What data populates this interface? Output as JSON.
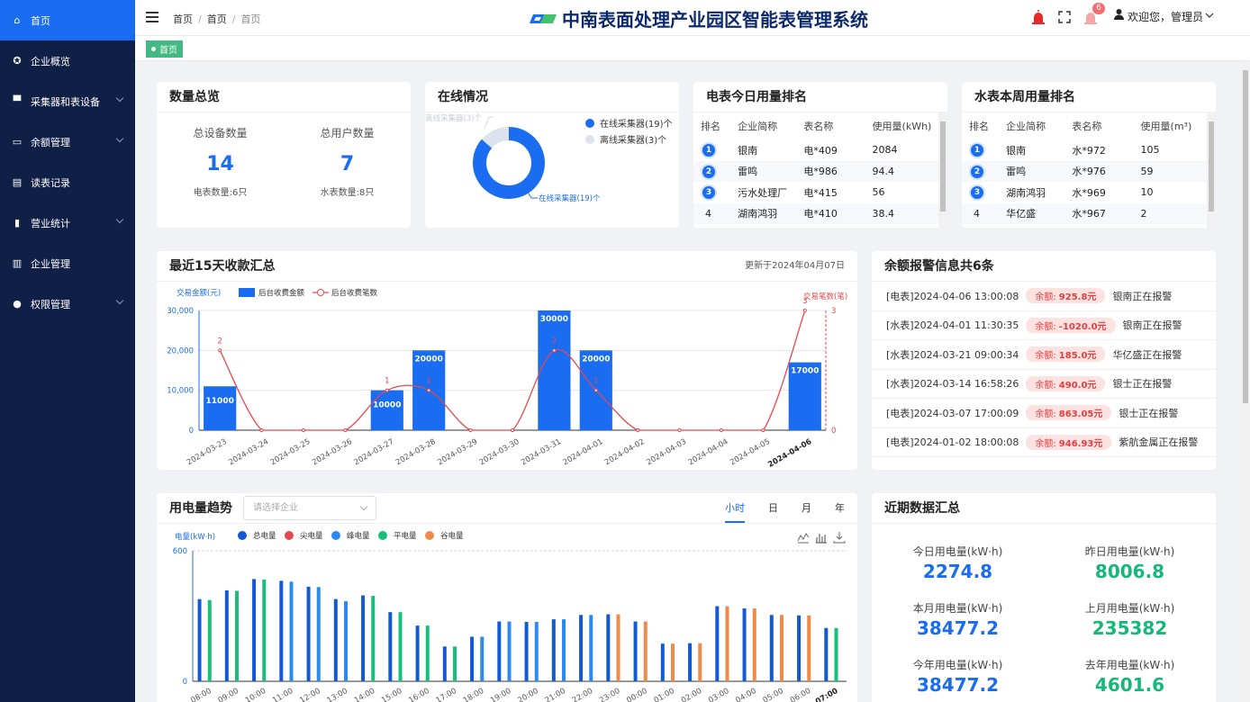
{
  "sidebar": {
    "items": [
      {
        "label": "首页",
        "icon": "home-icon",
        "active": true,
        "has_arrow": false
      },
      {
        "label": "企业概览",
        "icon": "target-icon",
        "active": false,
        "has_arrow": false
      },
      {
        "label": "采集器和表设备",
        "icon": "briefcase-icon",
        "active": false,
        "has_arrow": true
      },
      {
        "label": "余额管理",
        "icon": "folder-icon",
        "active": false,
        "has_arrow": true
      },
      {
        "label": "读表记录",
        "icon": "document-icon",
        "active": false,
        "has_arrow": false
      },
      {
        "label": "营业统计",
        "icon": "bar-chart-icon",
        "active": false,
        "has_arrow": true
      },
      {
        "label": "企业管理",
        "icon": "company-icon",
        "active": false,
        "has_arrow": false
      },
      {
        "label": "权限管理",
        "icon": "user-icon",
        "active": false,
        "has_arrow": true
      }
    ]
  },
  "header": {
    "breadcrumb": [
      "首页",
      "首页",
      "首页"
    ],
    "app_title": "中南表面处理产业园区智能表管理系统",
    "notification_count": "6",
    "greeting": "欢迎您，管理员"
  },
  "tabs": {
    "active_tab": "首页"
  },
  "overview": {
    "title": "数量总览",
    "total_devices_label": "总设备数量",
    "total_devices": "14",
    "electric_meters": "电表数量:6只",
    "total_users_label": "总用户数量",
    "total_users": "7",
    "water_meters": "水表数量:8只"
  },
  "online": {
    "title": "在线情况",
    "legend_online": "在线采集器(19)个",
    "legend_offline": "离线采集器(3)个",
    "label_online": "在线采集器(19)个",
    "label_offline": "离线采集器(3)个",
    "online_count": 19,
    "offline_count": 3,
    "online_color": "#1a6cf0",
    "offline_color": "#dde3ee"
  },
  "elec_rank": {
    "title": "电表今日用量排名",
    "headers": [
      "排名",
      "企业简称",
      "表名称",
      "使用量(kWh)"
    ],
    "rows": [
      {
        "rank": "1",
        "company": "银南",
        "meter": "电*409",
        "usage": "2084"
      },
      {
        "rank": "2",
        "company": "雷鸣",
        "meter": "电*986",
        "usage": "94.4"
      },
      {
        "rank": "3",
        "company": "污水处理厂",
        "meter": "电*415",
        "usage": "56"
      },
      {
        "rank": "4",
        "company": "湖南鸿羽",
        "meter": "电*410",
        "usage": "38.4"
      }
    ]
  },
  "water_rank": {
    "title": "水表本周用量排名",
    "headers": [
      "排名",
      "企业简称",
      "表名称",
      "使用量(m³)"
    ],
    "rows": [
      {
        "rank": "1",
        "company": "银南",
        "meter": "水*972",
        "usage": "105"
      },
      {
        "rank": "2",
        "company": "雷鸣",
        "meter": "水*976",
        "usage": "59"
      },
      {
        "rank": "3",
        "company": "湖南鸿羽",
        "meter": "水*969",
        "usage": "10"
      },
      {
        "rank": "4",
        "company": "华亿盛",
        "meter": "水*967",
        "usage": "2"
      }
    ]
  },
  "collections": {
    "title": "最近15天收款汇总",
    "updated": "更新于2024年04月07日"
  },
  "alerts": {
    "title": "余额报警信息共6条",
    "rows": [
      {
        "time": "[电表]2024-04-06 13:00:08",
        "prefix": "余额:",
        "amount": "925.8元",
        "status": "银南正在报警"
      },
      {
        "time": "[水表]2024-04-01 11:30:35",
        "prefix": "余额:",
        "amount": "-1020.0元",
        "status": "银南正在报警"
      },
      {
        "time": "[水表]2024-03-21 09:00:34",
        "prefix": "余额:",
        "amount": "185.0元",
        "status": "华亿盛正在报警"
      },
      {
        "time": "[水表]2024-03-14 16:58:26",
        "prefix": "余额:",
        "amount": "490.0元",
        "status": "银士正在报警"
      },
      {
        "time": "[电表]2024-03-07 17:00:09",
        "prefix": "余额:",
        "amount": "863.05元",
        "status": "银士正在报警"
      },
      {
        "time": "[电表]2024-01-02 18:00:08",
        "prefix": "余额:",
        "amount": "946.93元",
        "status": "紫航金属正在报警"
      }
    ]
  },
  "trend": {
    "title": "用电量趋势",
    "select_placeholder": "请选择企业",
    "period_tabs": [
      "小时",
      "日",
      "月",
      "年"
    ],
    "active_period": "小时"
  },
  "summary": {
    "title": "近期数据汇总",
    "items": [
      {
        "label": "今日用电量(kW·h)",
        "value": "2274.8",
        "color": "#1a6cf0"
      },
      {
        "label": "昨日用电量(kW·h)",
        "value": "8006.8",
        "color": "#16b87a"
      },
      {
        "label": "本月用电量(kW·h)",
        "value": "38477.2",
        "color": "#1a6cf0"
      },
      {
        "label": "上月用电量(kW·h)",
        "value": "235382",
        "color": "#16b87a"
      },
      {
        "label": "今年用电量(kW·h)",
        "value": "38477.2",
        "color": "#1a6cf0"
      },
      {
        "label": "去年用电量(kW·h)",
        "value": "4601.6",
        "color": "#16b87a"
      }
    ]
  },
  "chart_data": [
    {
      "type": "bar",
      "title": "最近15天收款汇总",
      "ylabel": "交易金额(元)",
      "y2label": "交易笔数(笔)",
      "categories": [
        "2024-03-23",
        "2024-03-24",
        "2024-03-25",
        "2024-03-26",
        "2024-03-27",
        "2024-03-28",
        "2024-03-29",
        "2024-03-30",
        "2024-03-31",
        "2024-04-01",
        "2024-04-02",
        "2024-04-03",
        "2024-04-04",
        "2024-04-05",
        "2024-04-06"
      ],
      "series": [
        {
          "name": "后台收费金额",
          "kind": "bar",
          "color": "#1a6cf0",
          "values": [
            11000,
            0,
            0,
            0,
            10000,
            20000,
            0,
            0,
            30000,
            20000,
            0,
            0,
            0,
            0,
            17000
          ]
        },
        {
          "name": "后台收费笔数",
          "kind": "line",
          "color": "#e5484d",
          "axis": "right",
          "values": [
            2,
            0,
            0,
            0,
            1,
            1,
            0,
            0,
            2,
            1,
            0,
            0,
            0,
            0,
            3
          ]
        }
      ],
      "ylim": [
        0,
        30000
      ],
      "yticks": [
        "0",
        "10,000",
        "20,000",
        "30,000"
      ],
      "y2lim": [
        0,
        3
      ],
      "y2ticks": [
        "0",
        "3"
      ],
      "grid": true
    },
    {
      "type": "bar",
      "title": "用电趋势",
      "ylabel": "电量(kW·h)",
      "ylim": [
        0,
        600
      ],
      "yticks": [
        "0",
        "600"
      ],
      "legend": [
        "总电量",
        "尖电量",
        "峰电量",
        "平电量",
        "谷电量"
      ],
      "colors": {
        "总电量": "#1259d6",
        "尖电量": "#e5484d",
        "峰电量": "#2a8af0",
        "平电量": "#16c07a",
        "谷电量": "#f08a4b"
      },
      "categories": [
        "08:00",
        "09:00",
        "10:00",
        "11:00",
        "12:00",
        "13:00",
        "14:00",
        "15:00",
        "16:00",
        "17:00",
        "18:00",
        "19:00",
        "20:00",
        "21:00",
        "22:00",
        "23:00",
        "00:00",
        "01:00",
        "02:00",
        "03:00",
        "04:00",
        "05:00",
        "06:00",
        "07:00"
      ],
      "bars": [
        [
          {
            "s": "总电量",
            "v": 378
          },
          {
            "s": "平电量",
            "v": 373
          }
        ],
        [
          {
            "s": "总电量",
            "v": 418
          },
          {
            "s": "平电量",
            "v": 416
          }
        ],
        [
          {
            "s": "总电量",
            "v": 470
          },
          {
            "s": "平电量",
            "v": 468
          }
        ],
        [
          {
            "s": "总电量",
            "v": 462
          },
          {
            "s": "峰电量",
            "v": 458
          }
        ],
        [
          {
            "s": "总电量",
            "v": 435
          },
          {
            "s": "峰电量",
            "v": 433
          }
        ],
        [
          {
            "s": "总电量",
            "v": 378
          },
          {
            "s": "峰电量",
            "v": 368
          }
        ],
        [
          {
            "s": "总电量",
            "v": 395
          },
          {
            "s": "平电量",
            "v": 393
          }
        ],
        [
          {
            "s": "总电量",
            "v": 318
          },
          {
            "s": "平电量",
            "v": 318
          }
        ],
        [
          {
            "s": "总电量",
            "v": 256
          },
          {
            "s": "平电量",
            "v": 256
          }
        ],
        [
          {
            "s": "总电量",
            "v": 160
          },
          {
            "s": "平电量",
            "v": 160
          }
        ],
        [
          {
            "s": "总电量",
            "v": 205
          },
          {
            "s": "峰电量",
            "v": 205
          }
        ],
        [
          {
            "s": "总电量",
            "v": 275
          },
          {
            "s": "峰电量",
            "v": 275
          }
        ],
        [
          {
            "s": "总电量",
            "v": 273
          },
          {
            "s": "峰电量",
            "v": 273
          }
        ],
        [
          {
            "s": "总电量",
            "v": 285
          },
          {
            "s": "峰电量",
            "v": 285
          }
        ],
        [
          {
            "s": "总电量",
            "v": 305
          },
          {
            "s": "峰电量",
            "v": 305
          }
        ],
        [
          {
            "s": "总电量",
            "v": 308
          },
          {
            "s": "谷电量",
            "v": 308
          }
        ],
        [
          {
            "s": "总电量",
            "v": 275
          },
          {
            "s": "谷电量",
            "v": 275
          }
        ],
        [
          {
            "s": "总电量",
            "v": 173
          },
          {
            "s": "谷电量",
            "v": 173
          }
        ],
        [
          {
            "s": "总电量",
            "v": 175
          },
          {
            "s": "谷电量",
            "v": 175
          }
        ],
        [
          {
            "s": "总电量",
            "v": 345
          },
          {
            "s": "谷电量",
            "v": 345
          }
        ],
        [
          {
            "s": "总电量",
            "v": 335
          },
          {
            "s": "谷电量",
            "v": 335
          }
        ],
        [
          {
            "s": "总电量",
            "v": 305
          },
          {
            "s": "谷电量",
            "v": 305
          }
        ],
        [
          {
            "s": "总电量",
            "v": 303
          },
          {
            "s": "谷电量",
            "v": 303
          }
        ],
        [
          {
            "s": "总电量",
            "v": 245
          },
          {
            "s": "平电量",
            "v": 245
          }
        ]
      ]
    }
  ]
}
